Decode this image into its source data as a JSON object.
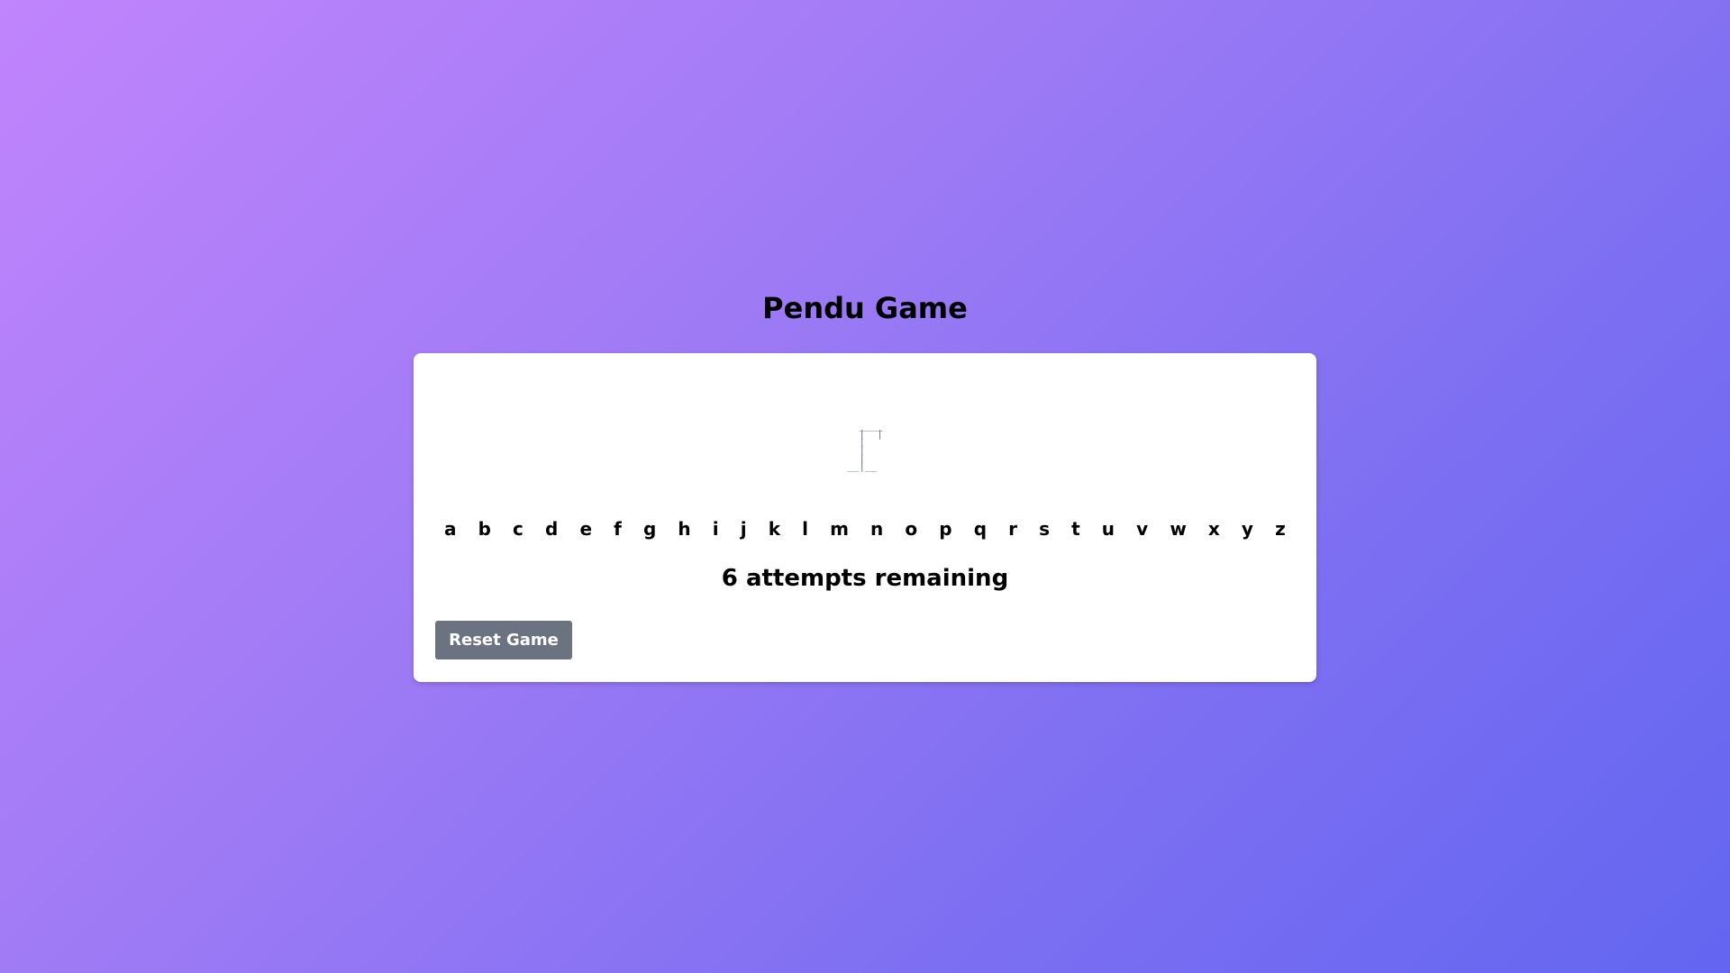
{
  "page": {
    "title": "Pendu Game"
  },
  "game": {
    "gallows_art": "  ____\n  |  |\n  |\n  |\n  |\n__|__",
    "letters": [
      "a",
      "b",
      "c",
      "d",
      "e",
      "f",
      "g",
      "h",
      "i",
      "j",
      "k",
      "l",
      "m",
      "n",
      "o",
      "p",
      "q",
      "r",
      "s",
      "t",
      "u",
      "v",
      "w",
      "x",
      "y",
      "z"
    ],
    "status": "6 attempts remaining",
    "reset_label": "Reset Game"
  },
  "colors": {
    "background_start": "#c084fc",
    "background_end": "#6366f1",
    "button": "#6b7280",
    "card": "#ffffff"
  }
}
